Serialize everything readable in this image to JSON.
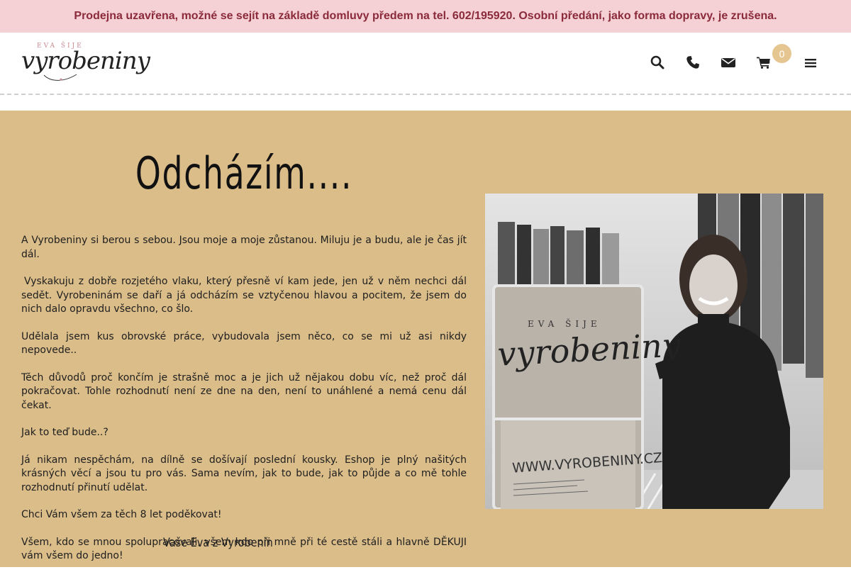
{
  "announcement": "Prodejna uzavřena, možné se sejít na základě domluvy předem na tel. 602/195920. Osobní předání, jako forma dopravy, je zrušena.",
  "logo": {
    "small_text": "EVA ŠIJE",
    "main_text": "vyrobeniny"
  },
  "header": {
    "icons": [
      "search-icon",
      "phone-icon",
      "mail-icon",
      "cart-icon",
      "menu-icon"
    ],
    "cart_count": "0"
  },
  "banner": {
    "heading": "Odcházím....",
    "paragraphs": [
      "A Vyrobeniny si berou s sebou. Jsou moje a moje zůstanou. Miluju je a budu, ale je čas jít dál.",
      "Vyskakuju z dobře rozjetého vlaku, který přesně ví kam jede, jen už v něm nechci dál sedět. Vyrobeninám se daří a já odcházím se vztyčenou hlavou a pocitem, že jsem do nich dalo opravdu všechno, co šlo.",
      "Udělala jsem kus obrovské práce, vybudovala jsem něco, co se mi už asi nikdy nepovede..",
      "Těch důvodů proč končím je strašně moc a je jich už nějakou dobu víc, než proč dál pokračovat. Tohle rozhodnutí není ze dne na den, není to unáhlené a nemá cenu dál čekat.",
      "Jak to teď bude..?",
      "Já nikam nespěchám, na dílně se došívají poslední kousky. Eshop je plný našitých krásných věcí a jsou tu pro vás. Sama nevím, jak to bude, jak to půjde a co mě tohle rozhodnutí přinutí udělat.",
      "Chci Vám všem za těch 8 let poděkovat!",
      "Všem, kdo se mnou spolupracovali, všem kdo při mně při té cestě stáli a hlavně DĚKUJI vám všem do jedno!"
    ],
    "signature": "Vaše Eva z Vyrobenin",
    "photo": {
      "sign_small": "EVA ŠIJE",
      "sign_main": "vyrobeniny",
      "sign_web": "WWW.VYROBENINY.CZ"
    }
  },
  "colors": {
    "announce_bg": "#f5d0d5",
    "announce_text": "#8a2a3a",
    "banner_bg": "#dbbd8a",
    "badge_bg": "#e6c690"
  }
}
